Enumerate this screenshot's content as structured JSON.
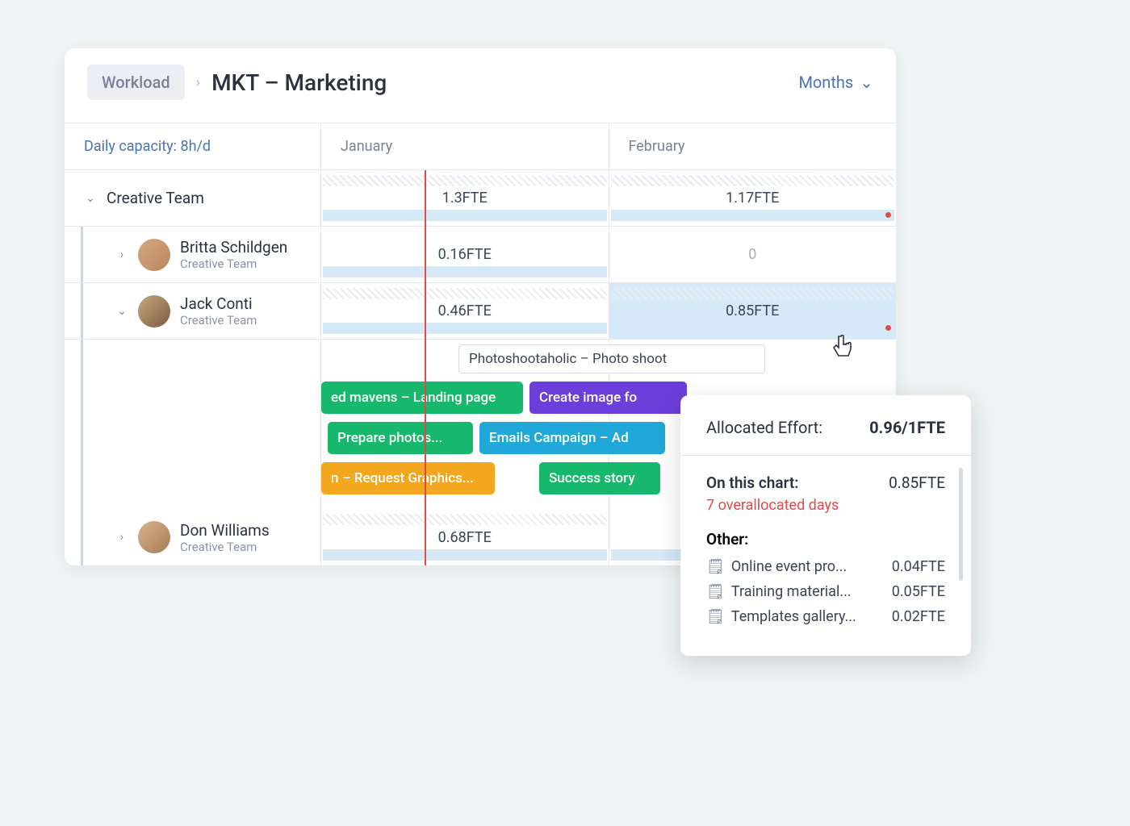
{
  "breadcrumb": {
    "root": "Workload",
    "title": "MKT – Marketing"
  },
  "view_dropdown": "Months",
  "capacity_label": "Daily capacity: 8h/d",
  "months": [
    "January",
    "February"
  ],
  "groups": [
    {
      "name": "Creative Team",
      "values": [
        "1.3FTE",
        "1.17FTE"
      ]
    }
  ],
  "people": [
    {
      "name": "Britta Schildgen",
      "team": "Creative Team",
      "values": [
        "0.16FTE",
        "0"
      ],
      "expanded": false
    },
    {
      "name": "Jack Conti",
      "team": "Creative Team",
      "values": [
        "0.46FTE",
        "0.85FTE"
      ],
      "expanded": true
    },
    {
      "name": "Don Williams",
      "team": "Creative Team",
      "values": [
        "0.68FTE",
        ""
      ],
      "expanded": false
    }
  ],
  "tasks": {
    "outline": "Photoshootaholic – Photo shoot",
    "bars": [
      {
        "label": "ed mavens – Landing page",
        "color": "green"
      },
      {
        "label": "Create image fo",
        "color": "purple"
      },
      {
        "label": "Prepare photos...",
        "color": "green"
      },
      {
        "label": "Emails Campaign – Ad",
        "color": "cyan"
      },
      {
        "label": "n – Request Graphics...",
        "color": "orange"
      },
      {
        "label": "Success story",
        "color": "green"
      }
    ]
  },
  "popover": {
    "title": "Allocated Effort:",
    "title_value": "0.96/1FTE",
    "on_chart_label": "On this chart:",
    "on_chart_value": "0.85FTE",
    "overallocated": "7 overallocated days",
    "other_label": "Other:",
    "other_items": [
      {
        "name": "Online event pro...",
        "fte": "0.04FTE"
      },
      {
        "name": "Training material...",
        "fte": "0.05FTE"
      },
      {
        "name": "Templates gallery...",
        "fte": "0.02FTE"
      }
    ]
  }
}
